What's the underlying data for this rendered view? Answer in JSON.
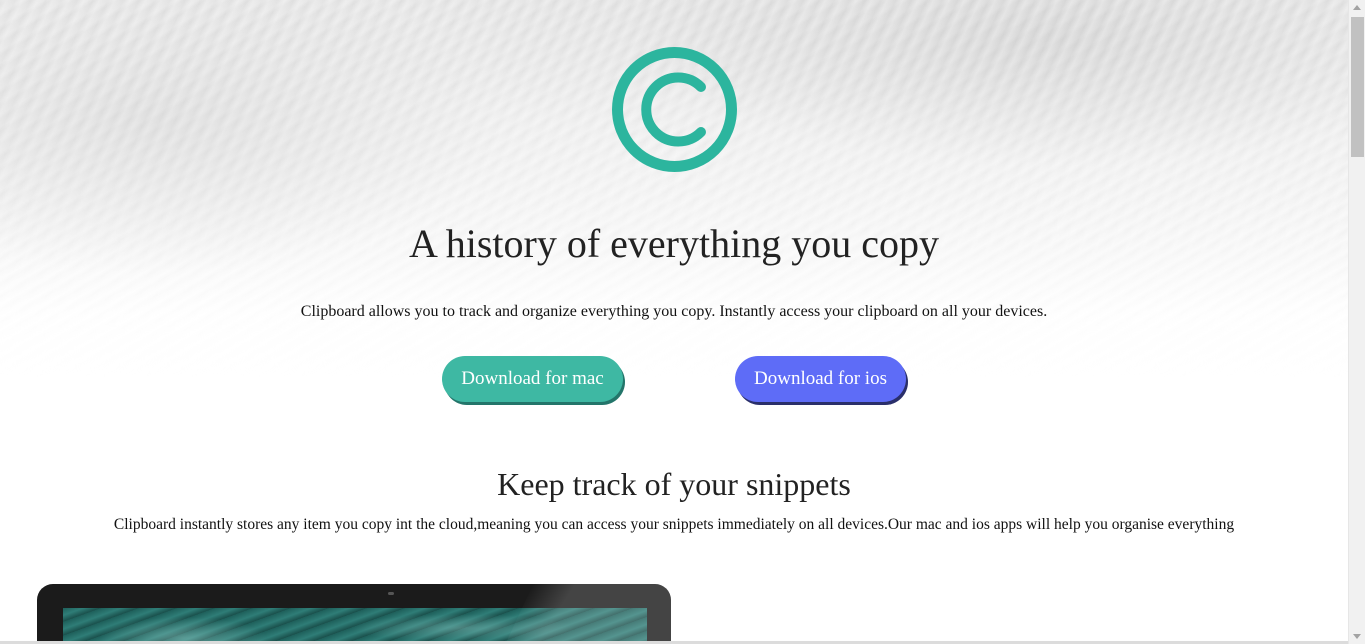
{
  "hero": {
    "logo_icon": "copyright-icon",
    "brand_color": "#2cb59e",
    "title": "A history of everything you copy",
    "subtitle": "Clipboard allows you to track and organize everything you copy. Instantly access your clipboard on all your devices.",
    "buttons": {
      "mac_label": "Download for mac",
      "ios_label": "Download for ios",
      "mac_color": "#3eb8a3",
      "ios_color": "#5e6cf7"
    }
  },
  "snippets": {
    "title": "Keep track of your snippets",
    "text": "Clipboard instantly stores any item you copy int the cloud,meaning you can access your snippets immediately on all devices.Our mac and ios apps will help you organise everything"
  },
  "scrollbar": {
    "up_icon": "arrow-up-icon",
    "down_icon": "arrow-down-icon"
  }
}
